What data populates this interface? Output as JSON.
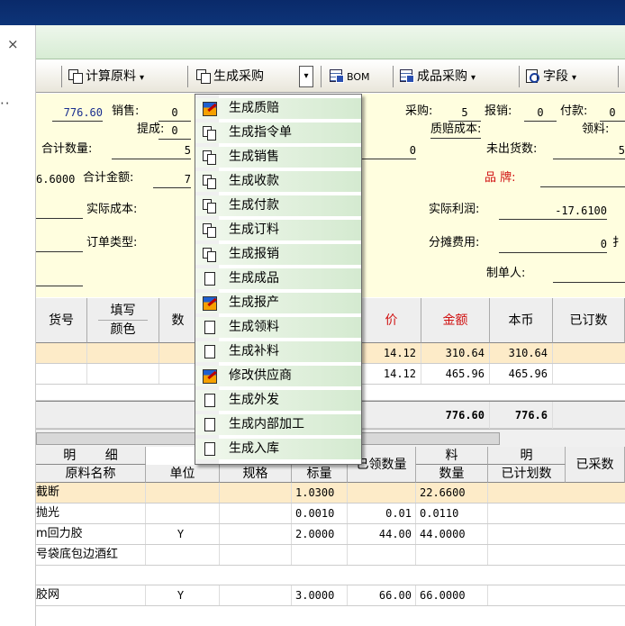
{
  "window": {
    "close_glyph": "×",
    "more_glyph": "··"
  },
  "toolbar": {
    "calc_material": "计算原料",
    "gen_purchase": "生成采购",
    "bom": "BOM",
    "product_purchase": "成品采购",
    "fields": "字段",
    "caret": "▾",
    "dropdown_arrow": "▾"
  },
  "header": {
    "amount_top": "776.60",
    "sales_label": "销售:",
    "sales_value": "0",
    "purchase_label": "采购:",
    "purchase_value": "5",
    "reimburse_label": "报销:",
    "reimburse_value": "0",
    "payment_label": "付款:",
    "payment_value": "0",
    "pickup_label": "提成:",
    "pickup_value": "0",
    "qc_cost_label": "质赔成本:",
    "material_label": "领料:",
    "total_qty_label": "合计数量:",
    "total_qty_value": "5",
    "qc_cost_value": "0",
    "undelivered_label": "未出货数:",
    "undelivered_value": "5",
    "amount_left": "6.6000",
    "total_amount_label": "合计金额:",
    "total_amount_value": "7",
    "brand_label": "品 牌:",
    "actual_cost_label": "实际成本:",
    "actual_profit_label": "实际利润:",
    "actual_profit_value": "-17.6100",
    "order_type_label": "订单类型:",
    "allocation_label": "分摊费用:",
    "allocation_value": "0",
    "allocation_tail": "扌",
    "creator_label": "制单人:"
  },
  "grid1": {
    "headers": {
      "no": "货号",
      "fill_1": "填写",
      "fill_2": "颜色",
      "qty": "数",
      "price": "价",
      "amount": "金额",
      "local": "本币",
      "ordered": "已订数"
    },
    "rows": [
      {
        "price": "14.12",
        "amount": "310.64",
        "local": "310.64"
      },
      {
        "price": "14.12",
        "amount": "465.96",
        "local": "465.96"
      }
    ],
    "total": {
      "amount": "776.60",
      "local": "776.6"
    }
  },
  "grid2": {
    "headers": {
      "detail_a": "明",
      "detail_b": "细",
      "material_name": "原料名称",
      "unit": "单位",
      "spec": "规格",
      "std_qty": "标量",
      "received": "已领数量",
      "material": "料",
      "qty": "数量",
      "plan_a": "明",
      "planned": "已计划数",
      "purchased": "已采数"
    },
    "rows": [
      {
        "name": "截断",
        "unit": "",
        "std": "1.0300",
        "recv": "",
        "qty": "22.6600"
      },
      {
        "name": "抛光",
        "unit": "",
        "std": "0.0010",
        "recv": "0.01",
        "qty": "0.0110"
      },
      {
        "name": "m回力胶",
        "unit": "Y",
        "std": "2.0000",
        "recv": "44.00",
        "qty": "44.0000"
      },
      {
        "name": "号袋底包边酒红",
        "unit": "",
        "std": "",
        "recv": "",
        "qty": ""
      },
      {
        "name": "胶网",
        "unit": "Y",
        "std": "3.0000",
        "recv": "66.00",
        "qty": "66.0000"
      }
    ]
  },
  "menu": {
    "items": [
      {
        "label": "生成质赔",
        "icon": "edit-icon"
      },
      {
        "label": "生成指令单",
        "icon": "copy-icon"
      },
      {
        "label": "生成销售",
        "icon": "copy-icon"
      },
      {
        "label": "生成收款",
        "icon": "copy-icon"
      },
      {
        "label": "生成付款",
        "icon": "copy-icon"
      },
      {
        "label": "生成订料",
        "icon": "copy-icon"
      },
      {
        "label": "生成报销",
        "icon": "copy-icon"
      },
      {
        "label": "生成成品",
        "icon": "document-icon"
      },
      {
        "label": "生成报产",
        "icon": "edit-icon"
      },
      {
        "label": "生成领料",
        "icon": "document-icon"
      },
      {
        "label": "生成补料",
        "icon": "document-icon"
      },
      {
        "label": "修改供应商",
        "icon": "edit-icon"
      },
      {
        "label": "生成外发",
        "icon": "document-icon"
      },
      {
        "label": "生成内部加工",
        "icon": "document-icon"
      },
      {
        "label": "生成入库",
        "icon": "document-icon"
      }
    ]
  },
  "colors": {
    "titlebar": "#0d3478",
    "header_bg": "#fffedf",
    "row_highlight": "#fdebc8",
    "red_text": "#d01010",
    "menu_green": "#d4ead0"
  }
}
